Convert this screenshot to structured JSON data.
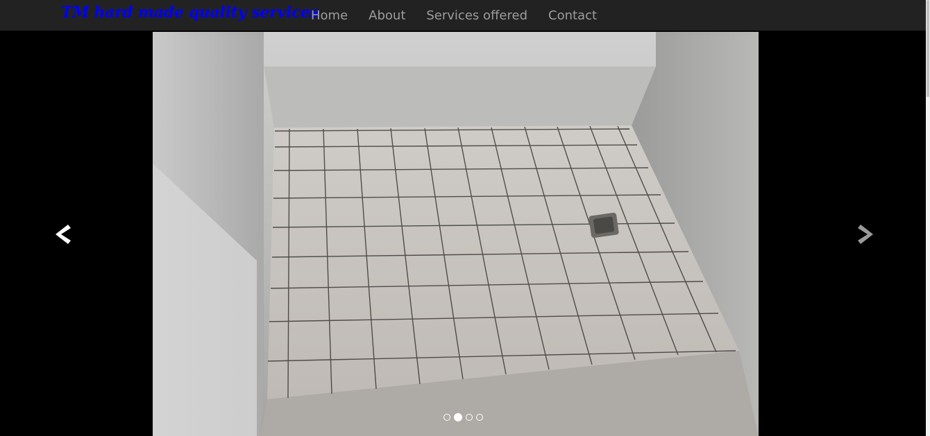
{
  "navbar": {
    "brand": "TM hard made quality services",
    "links": [
      "Home",
      "About",
      "Services offered",
      "Contact"
    ]
  },
  "carousel": {
    "slide_image": "tiled-shower-floor-photo",
    "prev_icon": "chevron-left-icon",
    "next_icon": "chevron-right-icon",
    "indicator_count": 4,
    "active_indicator": 2
  },
  "colors": {
    "navbar_bg": "#222222",
    "brand": "#0000ff",
    "nav_link": "#9d9d9d",
    "page_bg": "#000000"
  }
}
